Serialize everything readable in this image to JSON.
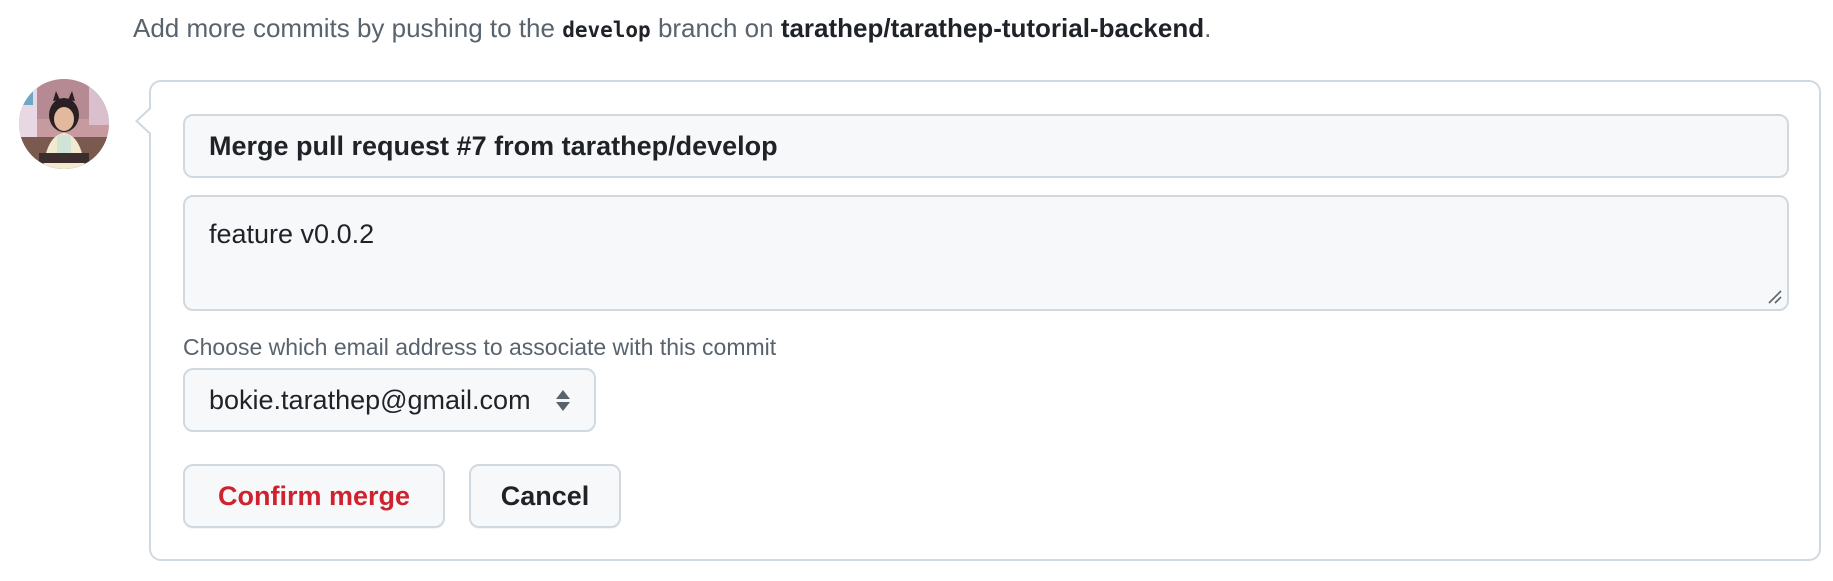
{
  "hint": {
    "prefix": "Add more commits by pushing to the ",
    "branch": "develop",
    "middle": " branch on ",
    "repo": "tarathep/tarathep-tutorial-backend",
    "suffix": "."
  },
  "avatar": {
    "icon": "user-avatar"
  },
  "merge_form": {
    "commit_title": "Merge pull request #7 from tarathep/develop",
    "commit_message": "feature v0.0.2",
    "email_label": "Choose which email address to associate with this commit",
    "email_selected": "bokie.tarathep@gmail.com",
    "confirm_label": "Confirm merge",
    "cancel_label": "Cancel"
  },
  "colors": {
    "confirm_text": "#cf222e",
    "border": "#d1d9e0",
    "field_bg": "#f6f8fa",
    "muted_text": "#59636e"
  }
}
